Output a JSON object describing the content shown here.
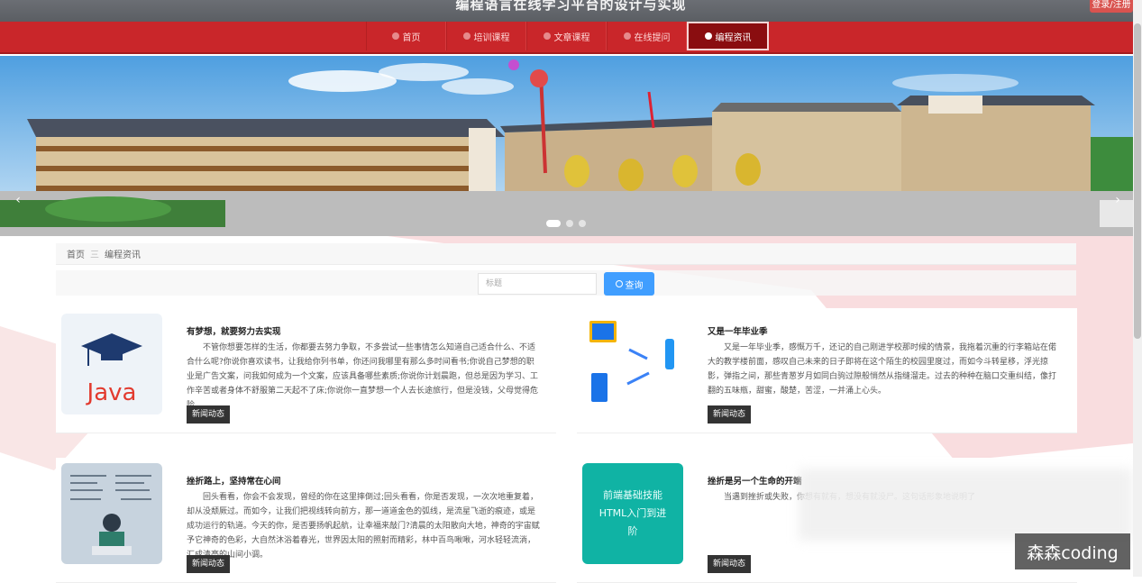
{
  "header": {
    "site_title": "编程语言在线学习平台的设计与实现",
    "login_button": "登录/注册"
  },
  "nav": {
    "items": [
      {
        "label": "首页"
      },
      {
        "label": "培训课程"
      },
      {
        "label": "文章课程"
      },
      {
        "label": "在线提问"
      },
      {
        "label": "编程资讯"
      }
    ],
    "active_index": 4
  },
  "breadcrumb": {
    "home": "首页",
    "separator": "三",
    "current": "编程资讯"
  },
  "search": {
    "placeholder": "标题",
    "button_label": "查询"
  },
  "articles": [
    {
      "title": "有梦想，就要努力去实现",
      "body": "不管你想要怎样的生活，你都要去努力争取，不多尝试一些事情怎么知道自己适合什么、不适合什么呢?你说你喜欢读书，让我给你列书单，你还问我哪里有那么多时间看书;你说自己梦想的职业是广告文案，问我如何成为一个文案，应该具备哪些素质;你说你计划晨跑，但总是因为学习、工作辛苦或者身体不舒服第二天起不了床;你说你一直梦想一个人去长途旅行，但是没钱，父母觉得危险。",
      "tag": "新闻动态",
      "thumb": "java-logo"
    },
    {
      "title": "又是一年毕业季",
      "body": "又是一年毕业季，感慨万千，还记的自己刚进学校那时候的情景，我拖着沉重的行李箱站在偌大的教学楼前面，感叹自己未来的日子即将在这个陌生的校园里度过，而如今斗转星移，浮光掠影，弹指之间，那些青葱岁月如同白驹过隙般悄然从指缝溜走。过去的种种在脑口交重纠结，像打翻的五味瓶，甜蜜，酸楚，苦涩，一并涌上心头。",
      "tag": "新闻动态",
      "thumb": "devices-illustration"
    },
    {
      "title": "挫折路上，坚持常在心间",
      "body": "回头看看，你会不会发现，曾经的你在这里摔倒过;回头看看，你是否发现，一次次地重复着，却从没颓厥过。而如今，让我们把视线转向前方，那一道道金色的弧线，是流星飞逝的痕迹，或是成功运行的轨道。今天的你，是否要扬帆起航，让幸福来敲门?清晨的太阳散向大地，神奇的宇宙赋予它神奇的色彩，大自然沐浴着春光，世界因太阳的照射而精彩，林中百鸟啾啾，河水轻轻流淌，汇成清亮的山间小调。",
      "tag": "新闻动态",
      "thumb": "coder-illustration"
    },
    {
      "title": "挫折是另一个生命的开端",
      "body": "当遇到挫折或失败，你想有就有，想没有就没尸。这句话形象地说明了",
      "tag": "新闻动态",
      "thumb": "html-course-cover",
      "thumb_text": "前端基础技能HTML入门到进阶"
    }
  ],
  "watermark": "森森coding",
  "colors": {
    "nav_red": "#c9262a",
    "nav_active": "#8a0d10",
    "search_blue": "#409eff",
    "tag_dark": "#333333"
  }
}
